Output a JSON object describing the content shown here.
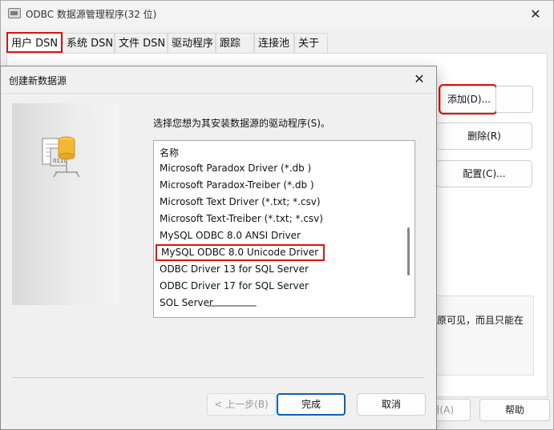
{
  "main_window": {
    "title": "ODBC 数据源管理程序(32 位)",
    "tabs": [
      "用户 DSN",
      "系统 DSN",
      "文件 DSN",
      "驱动程序",
      "跟踪",
      "连接池",
      "关于"
    ],
    "active_tab": "用户 DSN",
    "buttons": {
      "add": "添加(D)...",
      "remove": "删除(R)",
      "configure": "配置(C)..."
    },
    "description_partial_line1": "原可见，而且只能在",
    "bottom_buttons": {
      "apply_partial": "用(A)",
      "help": "帮助"
    }
  },
  "dialog": {
    "title": "创建新数据源",
    "prompt": "选择您想为其安装数据源的驱动程序(S)。",
    "list_header": "名称",
    "drivers": [
      "Microsoft Paradox Driver (*.db )",
      "Microsoft Paradox-Treiber (*.db )",
      "Microsoft Text Driver (*.txt; *.csv)",
      "Microsoft Text-Treiber (*.txt; *.csv)",
      "MySQL ODBC 8.0 ANSI Driver",
      "MySQL ODBC 8.0 Unicode Driver",
      "ODBC Driver 13 for SQL Server",
      "ODBC Driver 17 for SQL Server",
      "SQL Server"
    ],
    "selected_driver": "MySQL ODBC 8.0 Unicode Driver",
    "buttons": {
      "back": "< 上一步(B)",
      "finish": "完成",
      "cancel": "取消"
    }
  },
  "colors": {
    "highlight_outline": "#dd1111",
    "primary_button_border": "#0f5fb8"
  }
}
